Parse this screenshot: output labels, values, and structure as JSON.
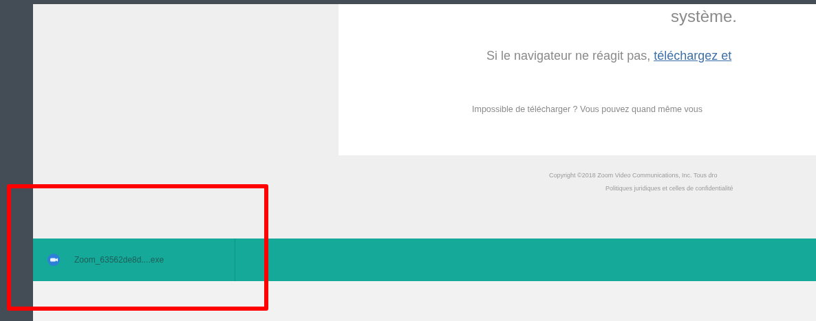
{
  "page": {
    "heading_end": "système.",
    "fallback_text": "Si le navigateur ne réagit pas, ",
    "fallback_link": "téléchargez et",
    "hint": "Impossible de télécharger ? Vous pouvez quand même vous",
    "copyright": "Copyright ©2018 Zoom Video Communications, Inc. Tous dro",
    "legal": "Politiques juridiques et celles de confidentialité"
  },
  "download_bar": {
    "items": [
      {
        "filename": "Zoom_63562de8d....exe"
      }
    ]
  },
  "annotation": {
    "kind": "highlight-box"
  }
}
